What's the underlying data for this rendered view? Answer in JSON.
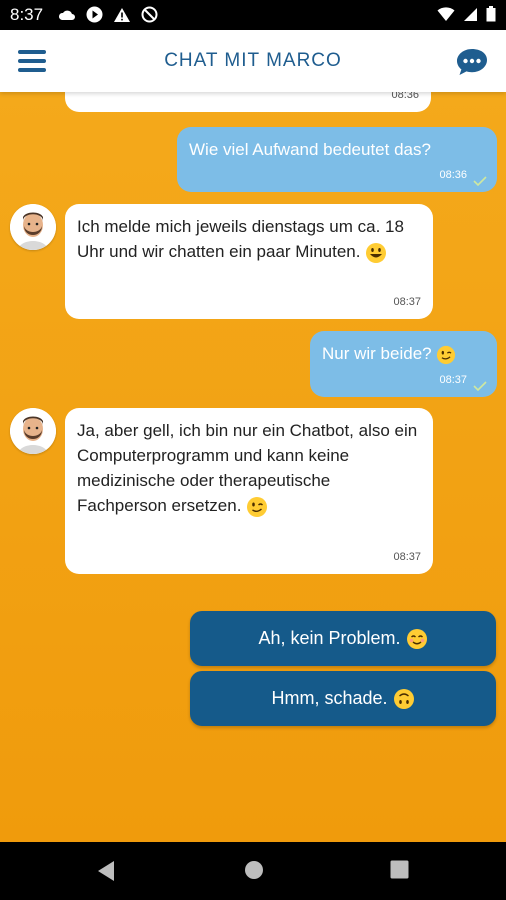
{
  "status_bar": {
    "time": "8:37"
  },
  "app_bar": {
    "title": "CHAT MIT MARCO",
    "menu_icon": "hamburger-menu-icon",
    "chat_icon": "chat-bubble-icon"
  },
  "colors": {
    "brand_blue": "#1f5d8f",
    "background_orange": "#f4a91b",
    "user_bubble": "#7dbde7",
    "reply_button": "#155a8a"
  },
  "messages": [
    {
      "from": "bot",
      "text": "",
      "time": "08:36"
    },
    {
      "from": "user",
      "text": "Wie viel Aufwand bedeutet das?",
      "time": "08:36"
    },
    {
      "from": "bot",
      "text": "Ich melde mich jeweils dienstags um ca. 18 Uhr und wir chatten ein paar Minuten.",
      "time": "08:37"
    },
    {
      "from": "user",
      "text": "Nur wir beide?",
      "time": "08:37"
    },
    {
      "from": "bot",
      "text": "Ja, aber gell, ich bin nur ein Chatbot, also ein Computerprogramm und kann keine medizinische oder therapeutische Fachperson ersetzen.",
      "time": "08:37"
    }
  ],
  "quick_replies": [
    {
      "label": "Ah, kein Problem."
    },
    {
      "label": "Hmm, schade."
    }
  ]
}
